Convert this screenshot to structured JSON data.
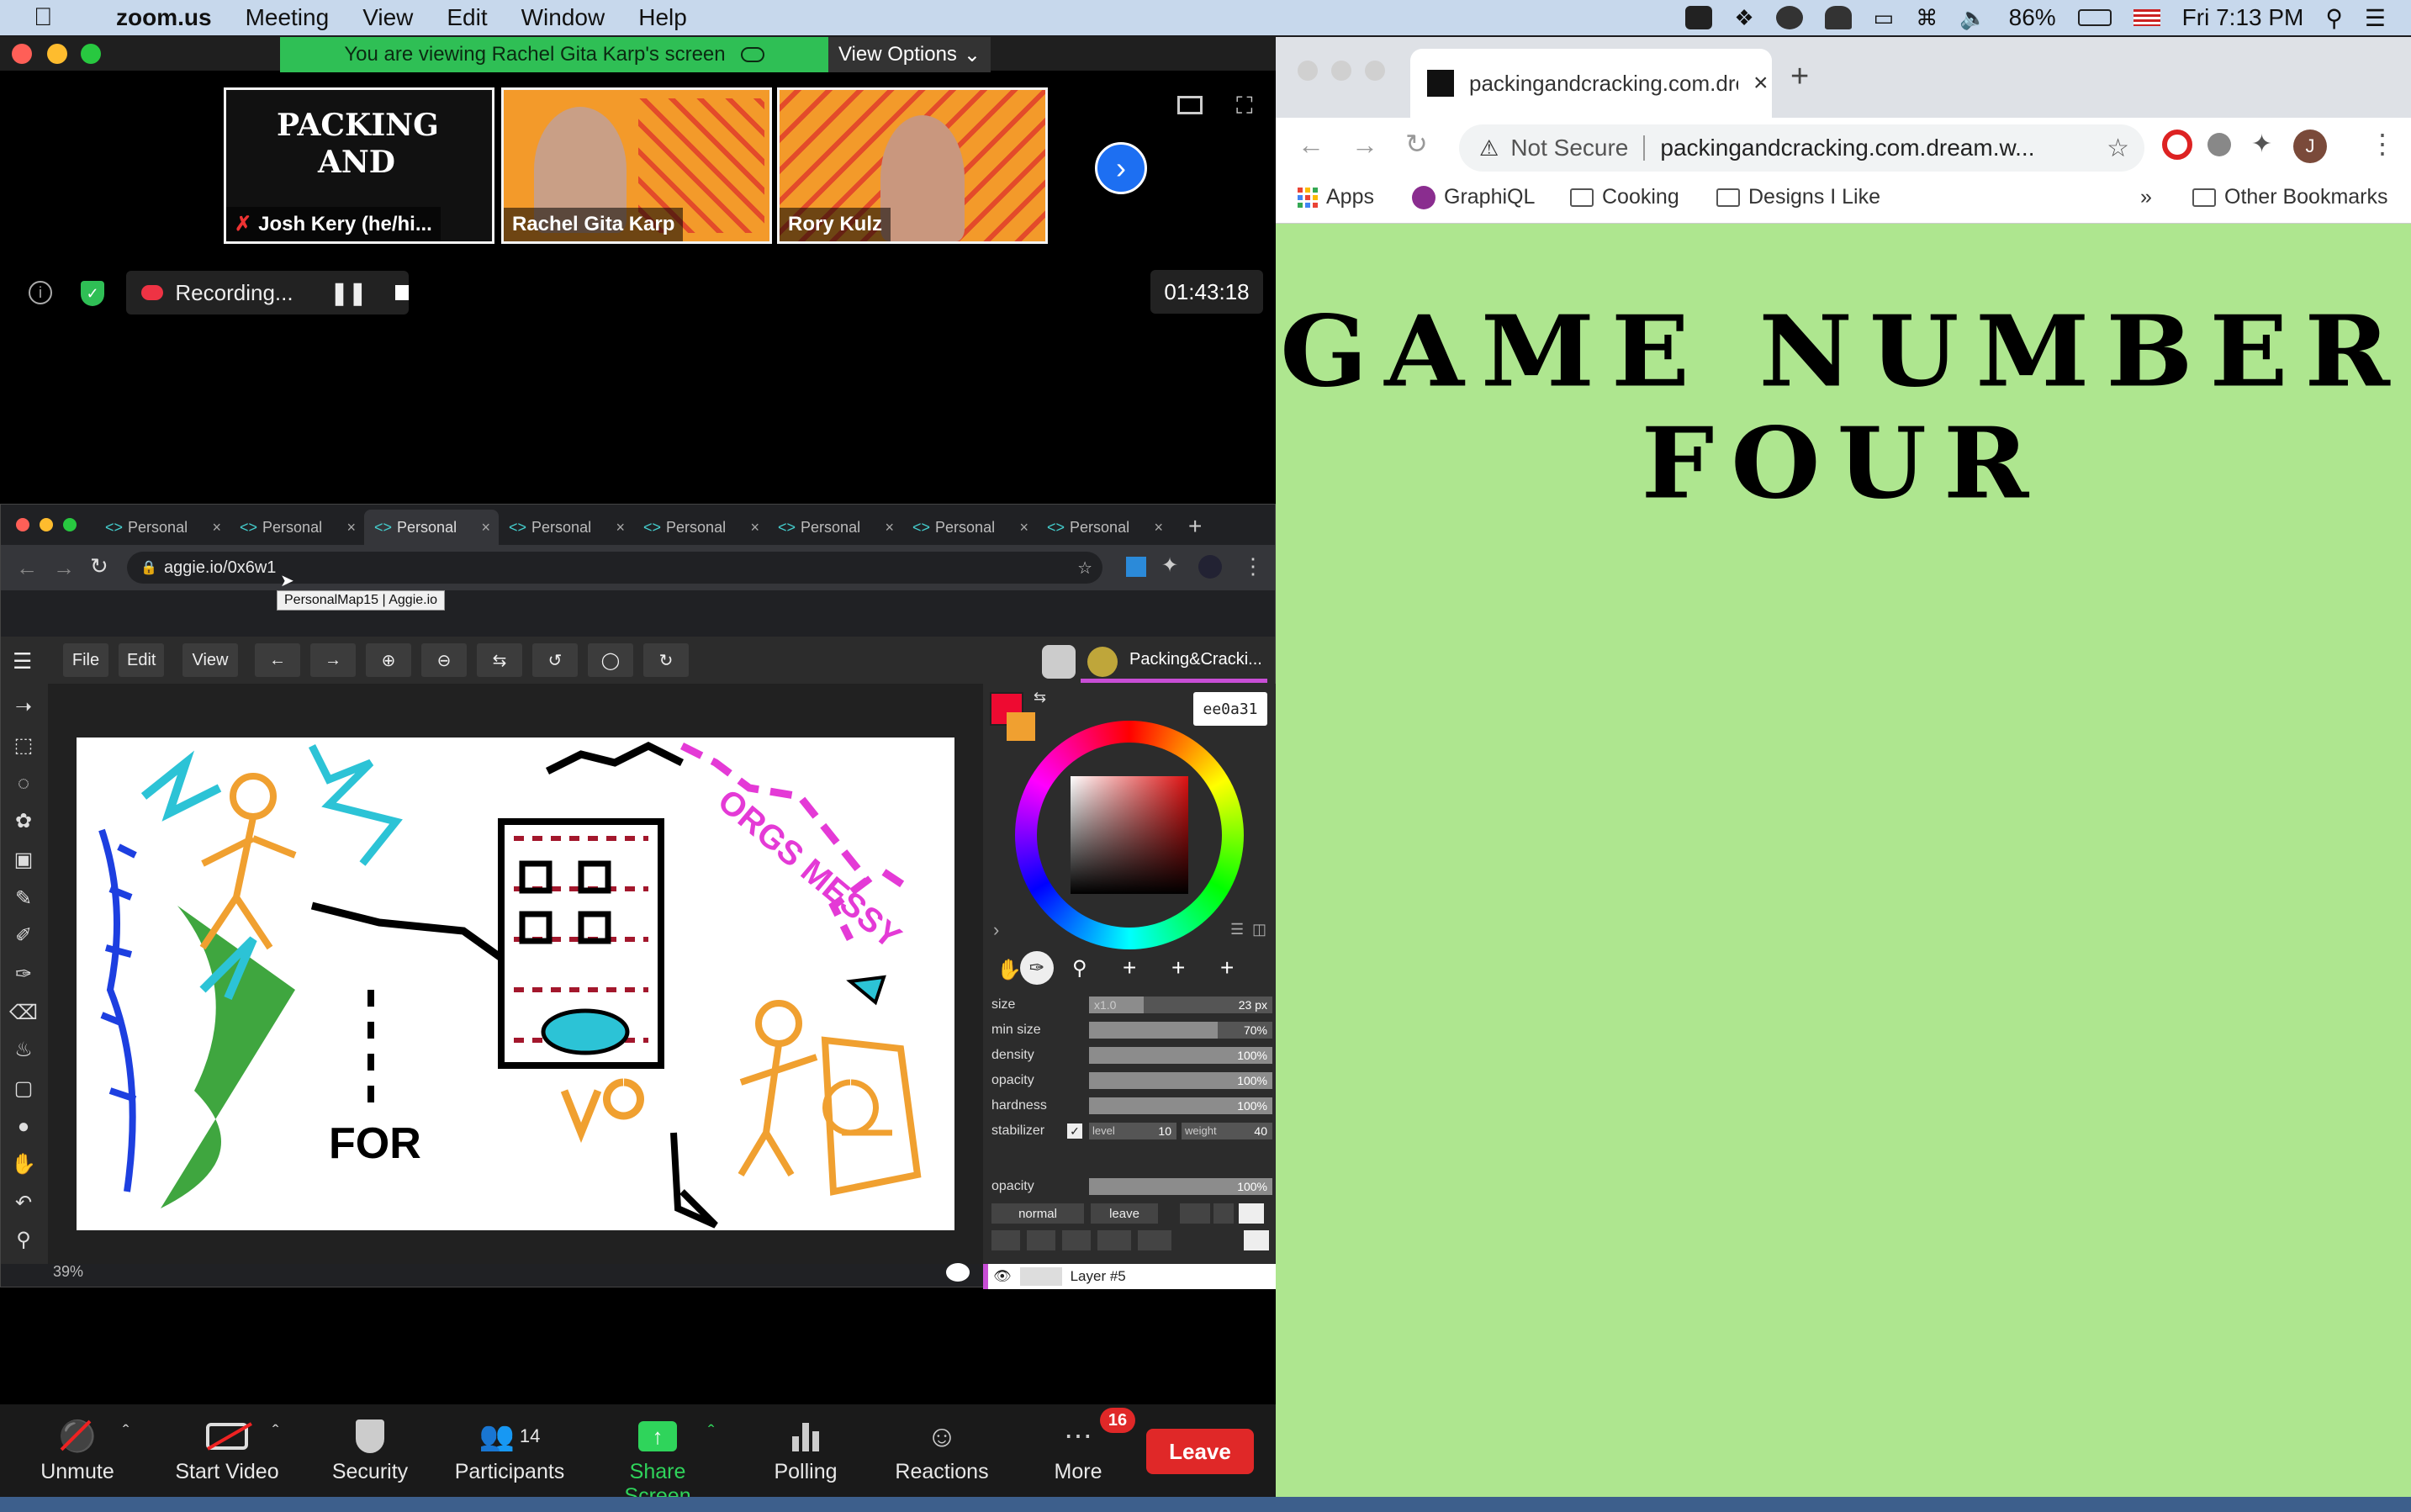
{
  "menubar": {
    "app_name": "zoom.us",
    "items": [
      "Meeting",
      "View",
      "Edit",
      "Window",
      "Help"
    ],
    "battery": "86%",
    "clock": "Fri 7:13 PM"
  },
  "zoom": {
    "banner_text": "You are viewing Rachel Gita Karp's screen",
    "view_options": "View Options",
    "participants_tiles": [
      {
        "name": "Josh Kery (he/hi..."
      },
      {
        "name": "Rachel Gita Karp"
      },
      {
        "name": "Rory Kulz"
      }
    ],
    "recording_label": "Recording...",
    "timer": "01:43:18",
    "bottom_bar": {
      "unmute": "Unmute",
      "start_video": "Start Video",
      "security": "Security",
      "participants": "Participants",
      "participants_count": "14",
      "share_screen": "Share Screen",
      "polling": "Polling",
      "reactions": "Reactions",
      "more": "More",
      "more_badge": "16",
      "leave": "Leave"
    }
  },
  "shared_browser": {
    "tabs": [
      "Personal",
      "Personal",
      "Personal",
      "Personal",
      "Personal",
      "Personal",
      "Personal",
      "Personal"
    ],
    "url": "aggie.io/0x6w1",
    "tooltip": "PersonalMap15 | Aggie.io",
    "toolbar": {
      "file": "File",
      "edit": "Edit",
      "view": "View"
    },
    "room_name": "Packing&Cracki...",
    "hex_color": "ee0a31",
    "zoom_level": "39%",
    "brush": {
      "size_label": "size",
      "size_mult": "x1.0",
      "size_value": "23 px",
      "min_size_label": "min size",
      "min_size_value": "70%",
      "min_size_fraction": 0.7,
      "density_label": "density",
      "density_value": "100%",
      "opacity_label": "opacity",
      "opacity_value": "100%",
      "hardness_label": "hardness",
      "hardness_value": "100%",
      "stabilizer_label": "stabilizer",
      "level_label": "level",
      "level_value": "10",
      "weight_label": "weight",
      "weight_value": "40"
    },
    "layer": {
      "opacity_label": "opacity",
      "opacity_value": "100%",
      "blend_mode": "normal",
      "leave": "leave",
      "layer_name": "Layer #5"
    },
    "canvas_text": [
      "FOR",
      "ORGS MESSY"
    ],
    "colors": {
      "primary": "#ee0a31",
      "secondary": "#f0a030"
    }
  },
  "chrome": {
    "tab_title": "packingandcracking.com.drea",
    "not_secure": "Not Secure",
    "url": "packingandcracking.com.dream.w...",
    "avatar_letter": "J",
    "bookmarks": {
      "apps": "Apps",
      "graphiql": "GraphiQL",
      "cooking": "Cooking",
      "designs": "Designs I Like",
      "more": "»",
      "other": "Other Bookmarks"
    },
    "page_title": "GAME NUMBER FOUR",
    "page_bg": "#aee68f"
  }
}
